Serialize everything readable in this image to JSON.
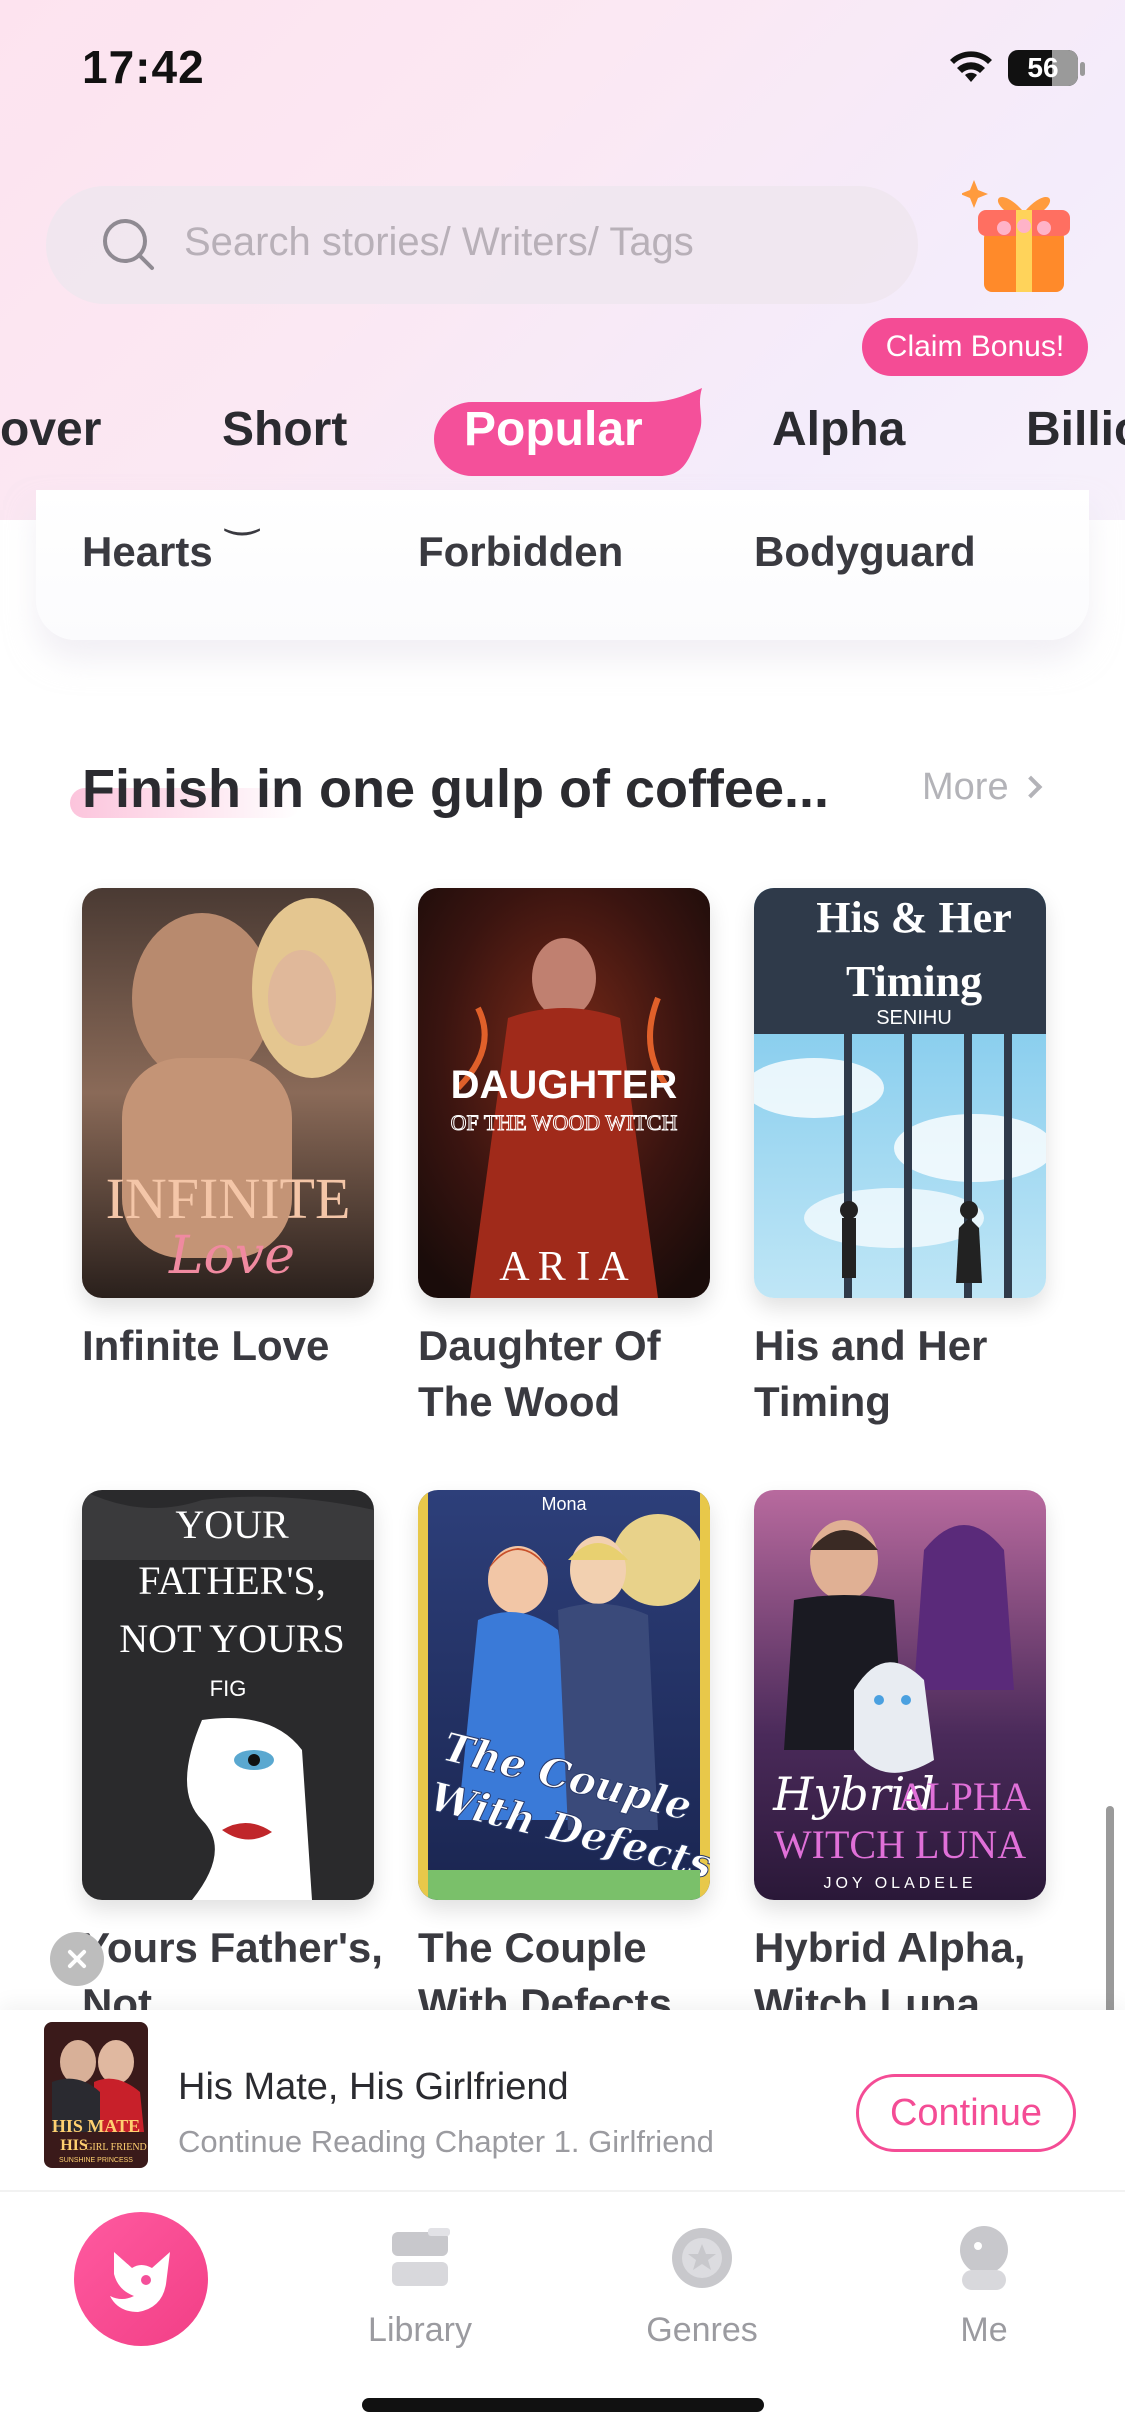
{
  "status_bar": {
    "time": "17:42",
    "battery": "56"
  },
  "search": {
    "placeholder": "Search stories/ Writers/ Tags"
  },
  "bonus": {
    "label": "Claim Bonus!"
  },
  "tabs": [
    {
      "label": "over"
    },
    {
      "label": "Short"
    },
    {
      "label": "Popular",
      "active": true
    },
    {
      "label": "Alpha"
    },
    {
      "label": "Billio"
    }
  ],
  "previous_row": {
    "titles": [
      "Hearts",
      "Forbidden",
      "Bodyguard"
    ]
  },
  "section": {
    "title": "Finish in one gulp of coffee...",
    "more": "More"
  },
  "books": [
    {
      "title": "Infinite Love",
      "cover_text": [
        "INFINITE",
        "Love"
      ]
    },
    {
      "title": "Daughter Of The Wood",
      "cover_text": [
        "DAUGHTER",
        "OF THE WOOD WITCH",
        "A R I A"
      ]
    },
    {
      "title": "His and Her Timing",
      "cover_text": [
        "His & Her",
        "Timing",
        "SENIHU"
      ]
    },
    {
      "title": "Yours Father's, Not",
      "cover_text": [
        "YOUR",
        "FATHER'S,",
        "NOT YOURS",
        "FIG"
      ]
    },
    {
      "title": "The Couple With Defects",
      "cover_text": [
        "The Couple",
        "With Defects",
        "Mona"
      ]
    },
    {
      "title": "Hybrid Alpha, Witch Luna",
      "cover_text": [
        "Hybrid",
        "ALPHA",
        "WITCH LUNA",
        "JOY OLADELE"
      ]
    }
  ],
  "continue_reading": {
    "title": "His Mate, His Girlfriend",
    "subtitle": "Continue Reading Chapter 1. Girlfriend",
    "button": "Continue",
    "cover_text": [
      "HIS MATE",
      "HIS",
      "GIRL FRIEND",
      "SUNSHINE PRINCESS"
    ]
  },
  "nav": {
    "library": "Library",
    "genres": "Genres",
    "me": "Me"
  },
  "colors": {
    "accent": "#f44c95",
    "text": "#2b2b30",
    "muted": "#9b9ba0"
  }
}
